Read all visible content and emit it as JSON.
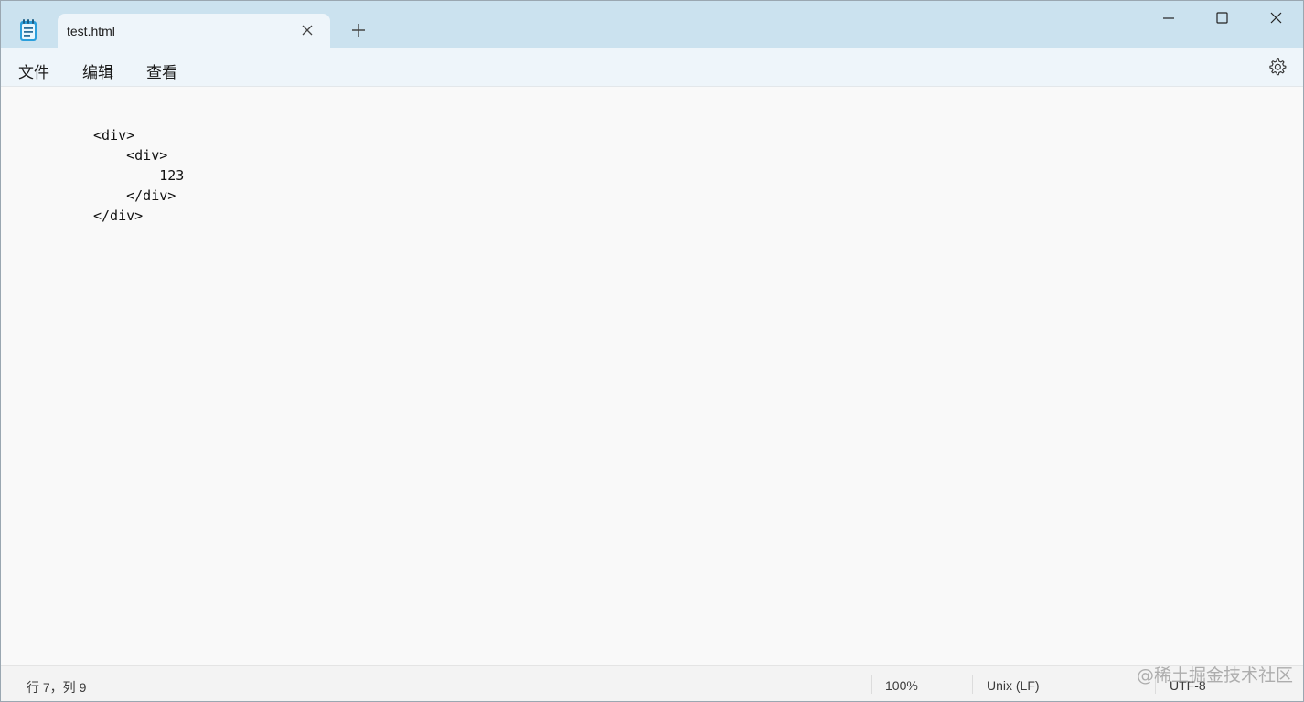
{
  "window": {
    "icon": "notepad-icon",
    "tab": {
      "title": "test.html",
      "close_icon": "close-icon"
    },
    "new_tab_icon": "plus-icon",
    "controls": [
      "minimize-icon",
      "maximize-icon",
      "close-icon"
    ]
  },
  "menu": {
    "file": "文件",
    "edit": "编辑",
    "view": "查看",
    "settings_icon": "gear-icon"
  },
  "editor": {
    "lines": [
      "<div>",
      "    <div>",
      "        123",
      "    </div>",
      "</div>"
    ]
  },
  "status": {
    "position": "行 7，列 9",
    "zoom": "100%",
    "line_ending": "Unix (LF)",
    "encoding": "UTF-8"
  },
  "watermark": "@稀土掘金技术社区",
  "colors": {
    "titlebar": "#cbe2ef",
    "active_tab": "#eef5fa",
    "editor_bg": "#f9f9f9",
    "statusbar": "#f3f3f3"
  }
}
